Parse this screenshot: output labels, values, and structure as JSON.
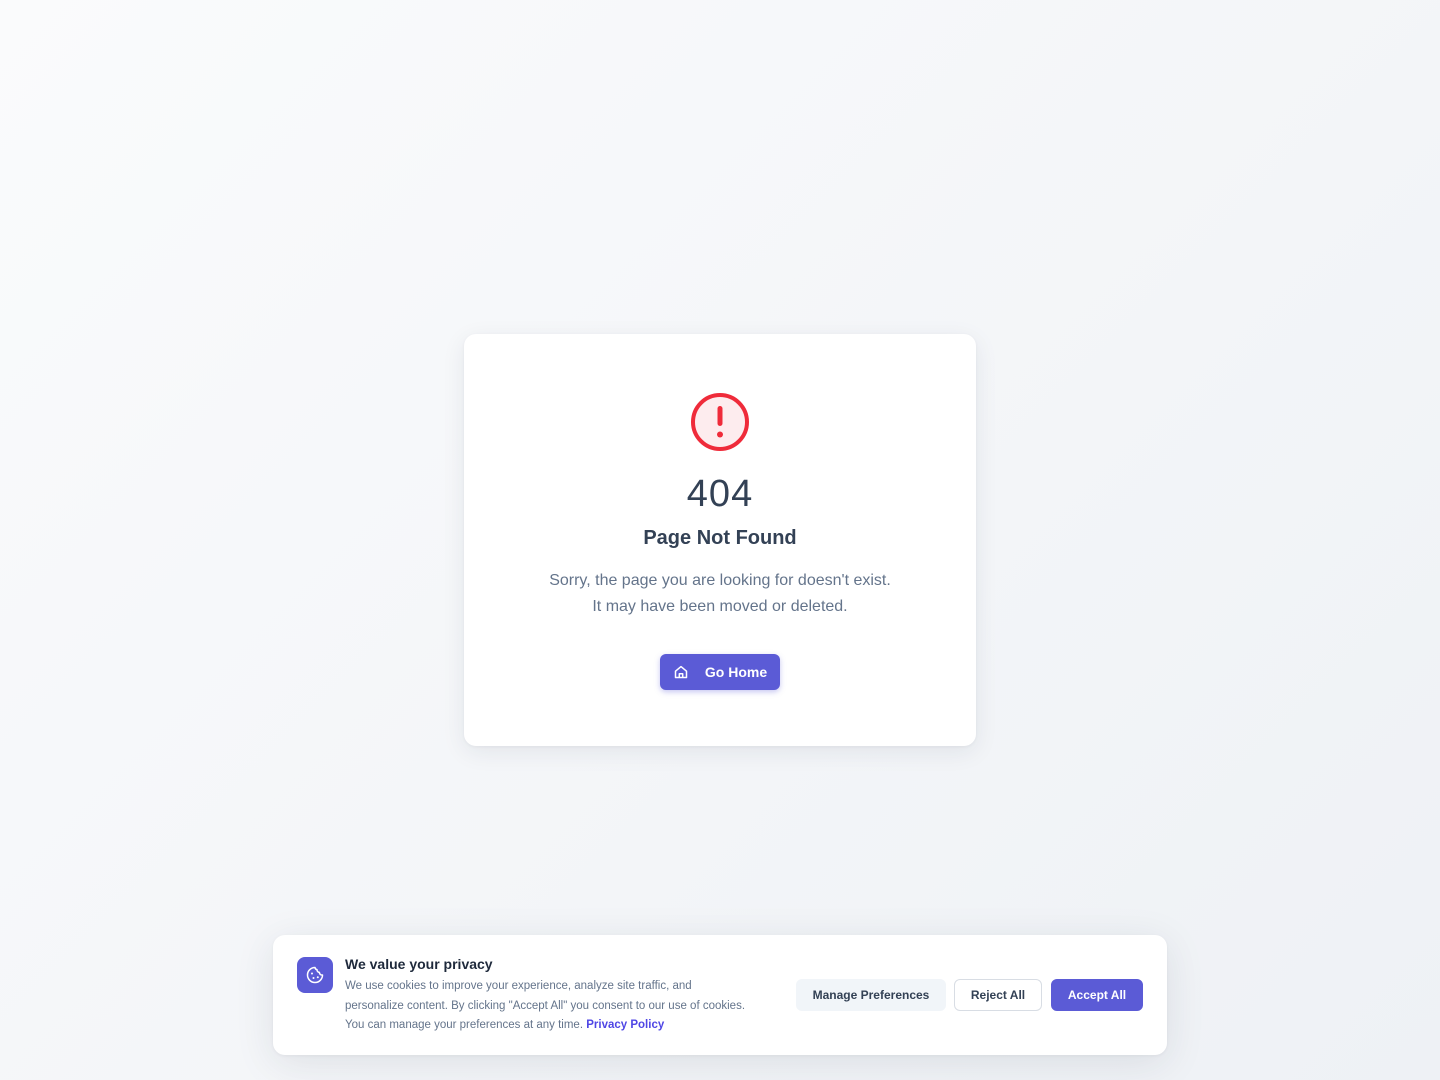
{
  "error_card": {
    "icon": "alert-circle-icon",
    "code": "404",
    "title": "Page Not Found",
    "message_line_1": "Sorry, the page you are looking for doesn't exist.",
    "message_line_2": "It may have been moved or deleted.",
    "button_icon": "home-icon",
    "button_label": "Go Home"
  },
  "cookie_banner": {
    "icon": "cookie-icon",
    "title": "We value your privacy",
    "text_line_1": "We use cookies to improve your experience, analyze site traffic, and",
    "text_line_2": "personalize content. By clicking \"Accept All\" you consent to our use of cookies.",
    "text_line_3": "You can manage your preferences at any time.",
    "privacy_link": "Privacy Policy",
    "manage_label": "Manage Preferences",
    "reject_label": "Reject All",
    "accept_label": "Accept All"
  },
  "colors": {
    "accent": "#5b5bd6",
    "error": "#ef2b3a",
    "error_bg": "#fdecee",
    "heading": "#334155",
    "body_text": "#64748b",
    "link": "#4f46e5"
  }
}
